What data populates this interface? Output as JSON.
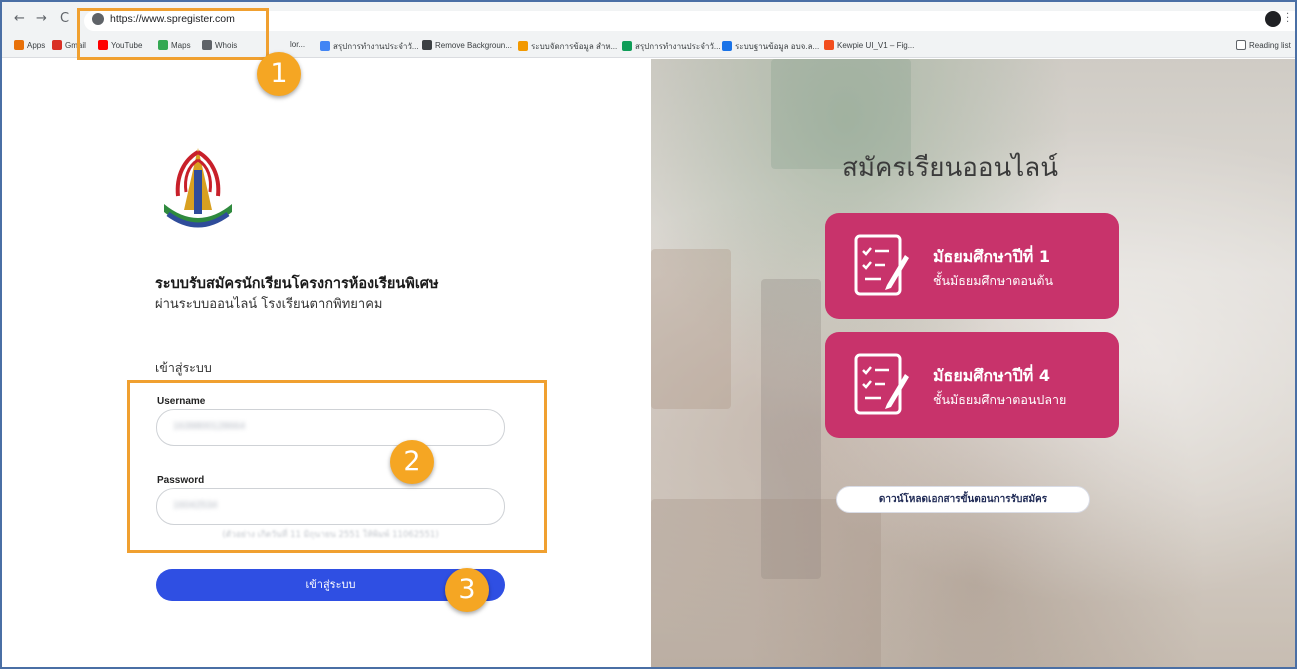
{
  "browser": {
    "url": "https://www.spregister.com",
    "nav_back": "←",
    "nav_forward": "→",
    "nav_reload": "C",
    "bookmarks": [
      {
        "label": "Apps",
        "icon": "apps-grid-icon",
        "color": "#e8710a"
      },
      {
        "label": "Gmail",
        "icon": "gmail-icon",
        "color": "#d93025"
      },
      {
        "label": "YouTube",
        "icon": "youtube-icon",
        "color": "#ff0000"
      },
      {
        "label": "Maps",
        "icon": "maps-pin-icon",
        "color": "#34a853"
      },
      {
        "label": "Whois",
        "icon": "globe-icon",
        "color": "#5f6368"
      },
      {
        "label": "lor...",
        "icon": "page-icon",
        "color": "#5f6368"
      },
      {
        "label": "สรุปการทำงานประจำวั...",
        "icon": "google-icon",
        "color": "#4285f4"
      },
      {
        "label": "Remove Backgroun...",
        "icon": "remove-bg-icon",
        "color": "#3c4043"
      },
      {
        "label": "ระบบจัดการข้อมูล สำห...",
        "icon": "sheet-icon",
        "color": "#f29900"
      },
      {
        "label": "สรุปการทำงานประจำวั...",
        "icon": "sheets-icon",
        "color": "#0f9d58"
      },
      {
        "label": "ระบบฐานข้อมูล อบจ.ล...",
        "icon": "drive-icon",
        "color": "#1a73e8"
      },
      {
        "label": "Kewpie UI_V1 – Fig...",
        "icon": "figma-icon",
        "color": "#f24e1e"
      }
    ],
    "reading_list": "Reading list"
  },
  "login": {
    "title_line1": "ระบบรับสมัครนักเรียนโครงการห้องเรียนพิเศษ",
    "title_line2": "ผ่านระบบออนไลน์ โรงเรียนตากพิทยาคม",
    "heading": "เข้าสู่ระบบ",
    "username_label": "Username",
    "username_value": "1639800128664",
    "password_label": "Password",
    "password_value": "16042534",
    "password_hint": "(ตัวอย่าง เกิดวันที่ 11 มิถุนายน 2551 ให้พิมพ์ 11062551)",
    "submit_label": "เข้าสู่ระบบ"
  },
  "callouts": {
    "badge_1": "1",
    "badge_2": "2",
    "badge_3": "3",
    "highlight_color": "#f0a030"
  },
  "banner": {
    "title": "สมัครเรียนออนไลน์",
    "cards": [
      {
        "line1": "มัธยมศึกษาปีที่ 1",
        "line2": "ชั้นมัธยมศึกษาตอนต้น"
      },
      {
        "line1": "มัธยมศึกษาปีที่ 4",
        "line2": "ชั้นมัธยมศึกษาตอนปลาย"
      }
    ],
    "download_label": "ดาวน์โหลดเอกสารขั้นตอนการรับสมัคร",
    "card_color": "#c8336b"
  }
}
